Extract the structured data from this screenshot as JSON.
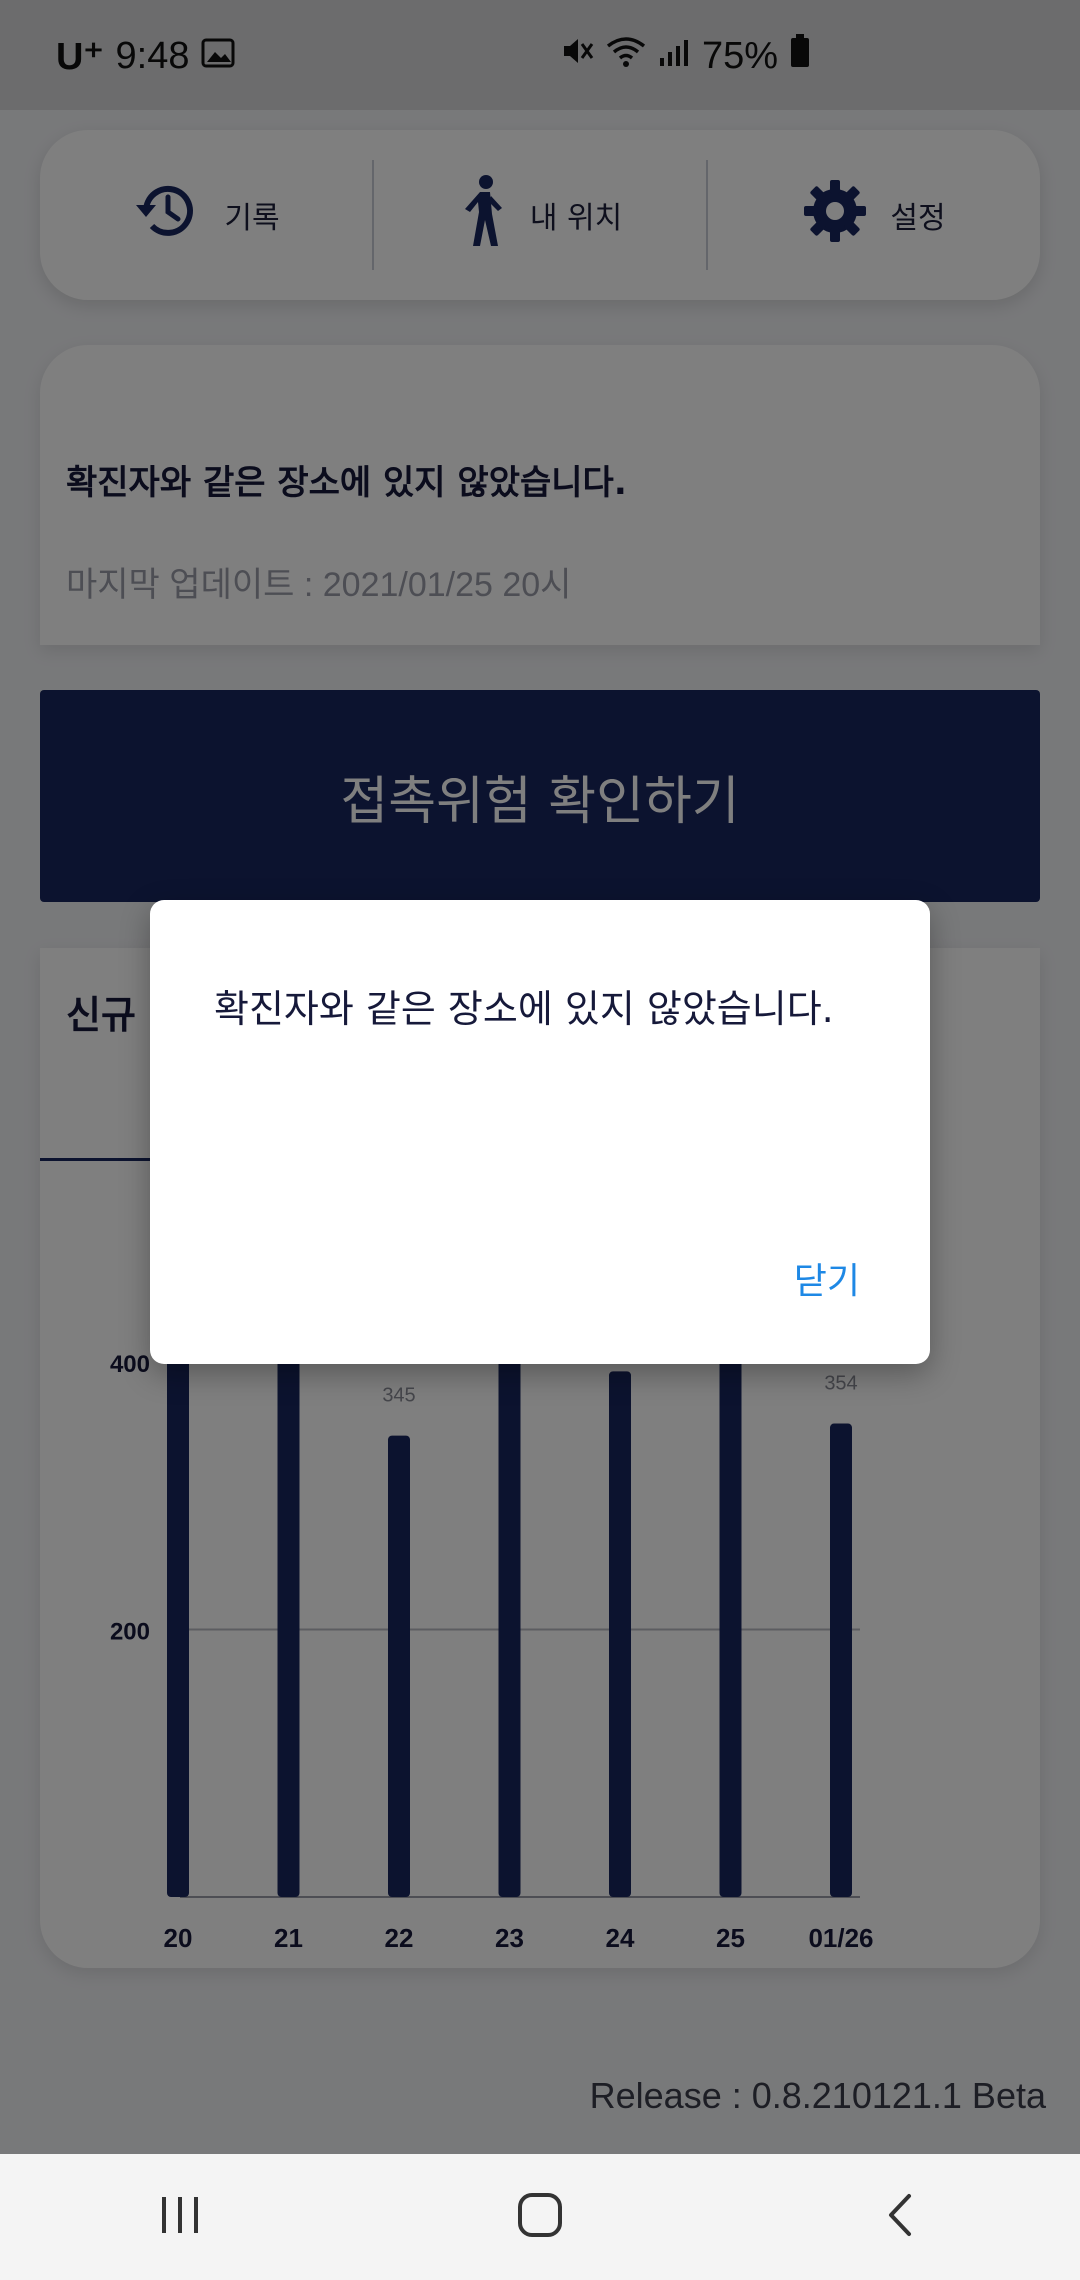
{
  "status_bar": {
    "carrier": "U⁺",
    "time": "9:48",
    "battery": "75%",
    "icons": [
      "image-icon",
      "mute-icon",
      "wifi-icon",
      "signal-icon",
      "battery-icon"
    ]
  },
  "nav": {
    "items": [
      {
        "label": "기록",
        "icon": "history-icon"
      },
      {
        "label": "내 위치",
        "icon": "walking-person-icon"
      },
      {
        "label": "설정",
        "icon": "gear-icon"
      }
    ]
  },
  "info": {
    "message": "확진자와 같은 장소에 있지 않았습니다.",
    "last_update": "마지막 업데이트 : 2021/01/25 20시"
  },
  "check_button": {
    "label": "접촉위험 확인하기"
  },
  "chart": {
    "title": "신규"
  },
  "chart_data": {
    "type": "bar",
    "categories": [
      "20",
      "21",
      "22",
      "23",
      "24",
      "25",
      "01/26"
    ],
    "values": [
      430,
      420,
      345,
      430,
      393,
      430,
      354
    ],
    "data_labels": [
      "",
      "",
      "345",
      "",
      "",
      "",
      "354"
    ],
    "y_ticks": [
      "200",
      "400"
    ],
    "ylim": [
      0,
      400
    ],
    "grid": true,
    "bar_color": "#18265e"
  },
  "release": "Release : 0.8.210121.1 Beta",
  "dialog": {
    "message": "확진자와 같은 장소에 있지 않았습니다.",
    "close_label": "닫기"
  },
  "system_nav": {
    "icons": [
      "recent-apps-icon",
      "home-icon",
      "back-icon"
    ]
  }
}
